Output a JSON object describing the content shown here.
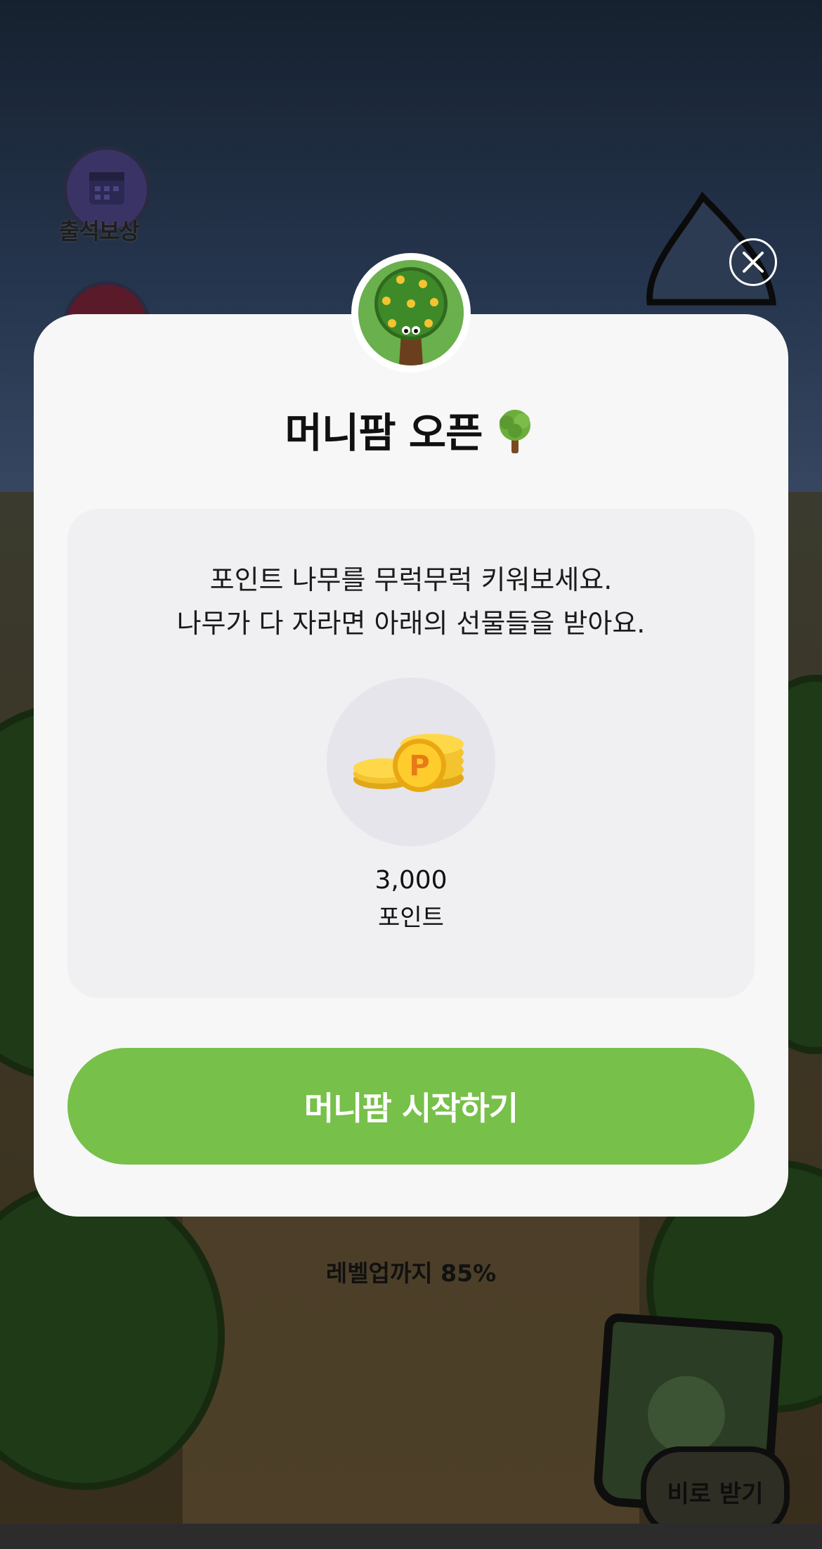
{
  "background": {
    "attendance_label": "출석보상",
    "progress_text": "레벨업까지 85%",
    "receive_now_label": "비로 받기"
  },
  "modal": {
    "title": "머니팜 오픈",
    "title_emoji": "🌳",
    "description_line1": "포인트 나무를 무럭무럭 키워보세요.",
    "description_line2": "나무가 다 자라면 아래의 선물들을 받아요.",
    "reward": {
      "amount": "3,000",
      "unit": "포인트",
      "icon": "coin-stack-icon"
    },
    "start_button_label": "머니팜 시작하기",
    "close_icon": "close-icon",
    "accent_color": "#77c04a"
  }
}
